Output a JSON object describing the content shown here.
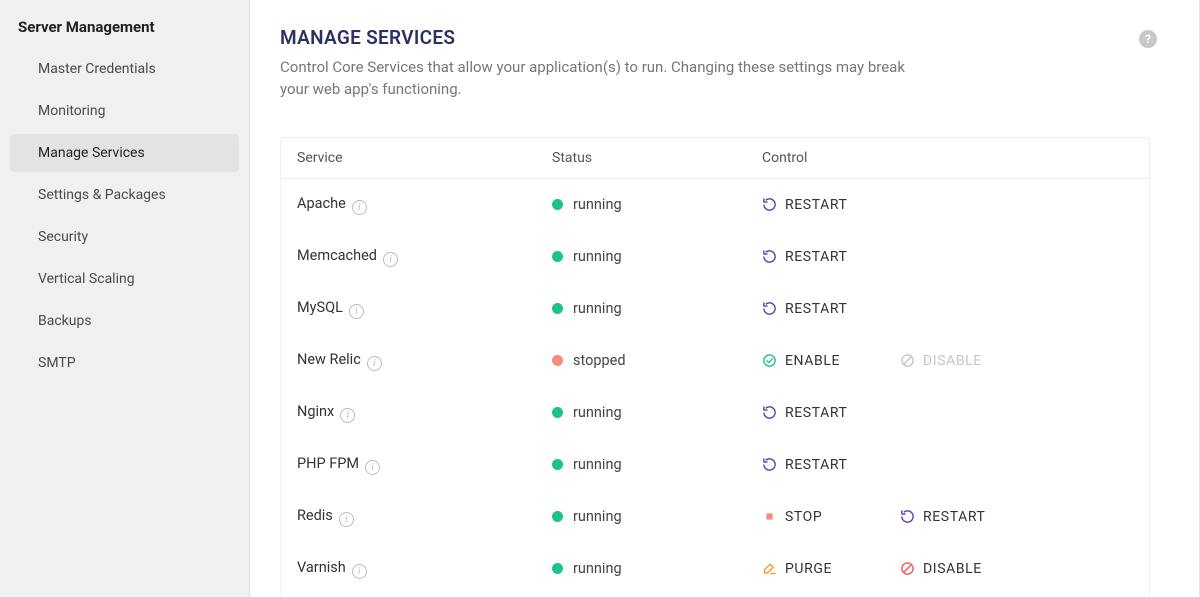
{
  "sidebar": {
    "title": "Server Management",
    "items": [
      {
        "label": "Master Credentials",
        "active": false
      },
      {
        "label": "Monitoring",
        "active": false
      },
      {
        "label": "Manage Services",
        "active": true
      },
      {
        "label": "Settings & Packages",
        "active": false
      },
      {
        "label": "Security",
        "active": false
      },
      {
        "label": "Vertical Scaling",
        "active": false
      },
      {
        "label": "Backups",
        "active": false
      },
      {
        "label": "SMTP",
        "active": false
      }
    ]
  },
  "page": {
    "title": "MANAGE SERVICES",
    "description": "Control Core Services that allow your application(s) to run. Changing these settings may break your web app's functioning."
  },
  "columns": {
    "service": "Service",
    "status": "Status",
    "control": "Control"
  },
  "status_labels": {
    "running": "running",
    "stopped": "stopped"
  },
  "colors": {
    "running": "#1fc28b",
    "stopped": "#f88c7a",
    "accent": "#2d3064",
    "restart_icon": "#5a3ea8",
    "enable_icon": "#1fc28b",
    "stop_icon": "#f88c7a",
    "purge_icon": "#ff9a3c",
    "disable_icon": "#f05a5a",
    "disabled_text": "#c6c6c6"
  },
  "actions": {
    "restart": "RESTART",
    "enable": "ENABLE",
    "disable": "DISABLE",
    "stop": "STOP",
    "purge": "PURGE"
  },
  "services": [
    {
      "name": "Apache",
      "status": "running",
      "controls": [
        {
          "type": "restart"
        }
      ]
    },
    {
      "name": "Memcached",
      "status": "running",
      "controls": [
        {
          "type": "restart"
        }
      ]
    },
    {
      "name": "MySQL",
      "status": "running",
      "controls": [
        {
          "type": "restart"
        }
      ]
    },
    {
      "name": "New Relic",
      "status": "stopped",
      "controls": [
        {
          "type": "enable"
        },
        {
          "type": "disable",
          "disabled": true
        }
      ]
    },
    {
      "name": "Nginx",
      "status": "running",
      "controls": [
        {
          "type": "restart"
        }
      ]
    },
    {
      "name": "PHP FPM",
      "status": "running",
      "controls": [
        {
          "type": "restart"
        }
      ]
    },
    {
      "name": "Redis",
      "status": "running",
      "controls": [
        {
          "type": "stop"
        },
        {
          "type": "restart"
        }
      ]
    },
    {
      "name": "Varnish",
      "status": "running",
      "controls": [
        {
          "type": "purge"
        },
        {
          "type": "disable"
        }
      ]
    }
  ]
}
